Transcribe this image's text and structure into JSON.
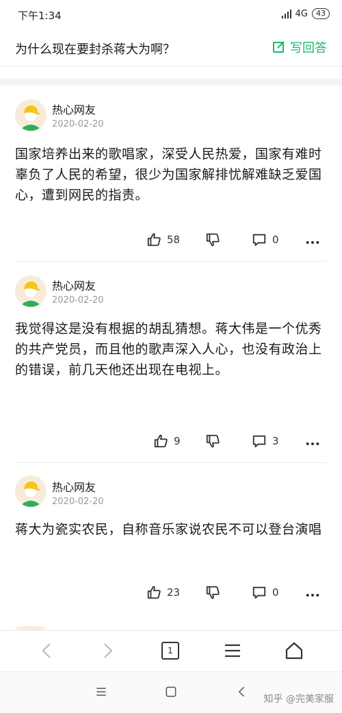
{
  "status": {
    "time": "下午1:34",
    "network": "4G",
    "battery": "43"
  },
  "question": {
    "title": "为什么现在要封杀蒋大为啊？",
    "write_answer": "写回答"
  },
  "answers": [
    {
      "author": "热心网友",
      "date": "2020-02-20",
      "content": "国家培养出来的歌唱家，深受人民热爱，国家有难时辜负了人民的希望，很少为国家解排忧解难缺乏爱国心，遭到网民的指责。",
      "likes": "58",
      "comments": "0"
    },
    {
      "author": "热心网友",
      "date": "2020-02-20",
      "content": "我觉得这是没有根据的胡乱猜想。蒋大伟是一个优秀的共产党员，而且他的歌声深入人心，也没有政治上的错误，前几天他还出现在电视上。",
      "likes": "9",
      "comments": "3"
    },
    {
      "author": "热心网友",
      "date": "2020-02-20",
      "content": "蒋大为瓷实农民，自称音乐家说农民不可以登台演唱",
      "likes": "23",
      "comments": "0"
    }
  ],
  "browser": {
    "tab_count": "1"
  },
  "watermark": "知乎 @完美家服",
  "colors": {
    "accent": "#1fb570",
    "avatar_bg": "#f7ecd9",
    "avatar_hat": "#f5c518",
    "avatar_shirt": "#2fae5e"
  }
}
